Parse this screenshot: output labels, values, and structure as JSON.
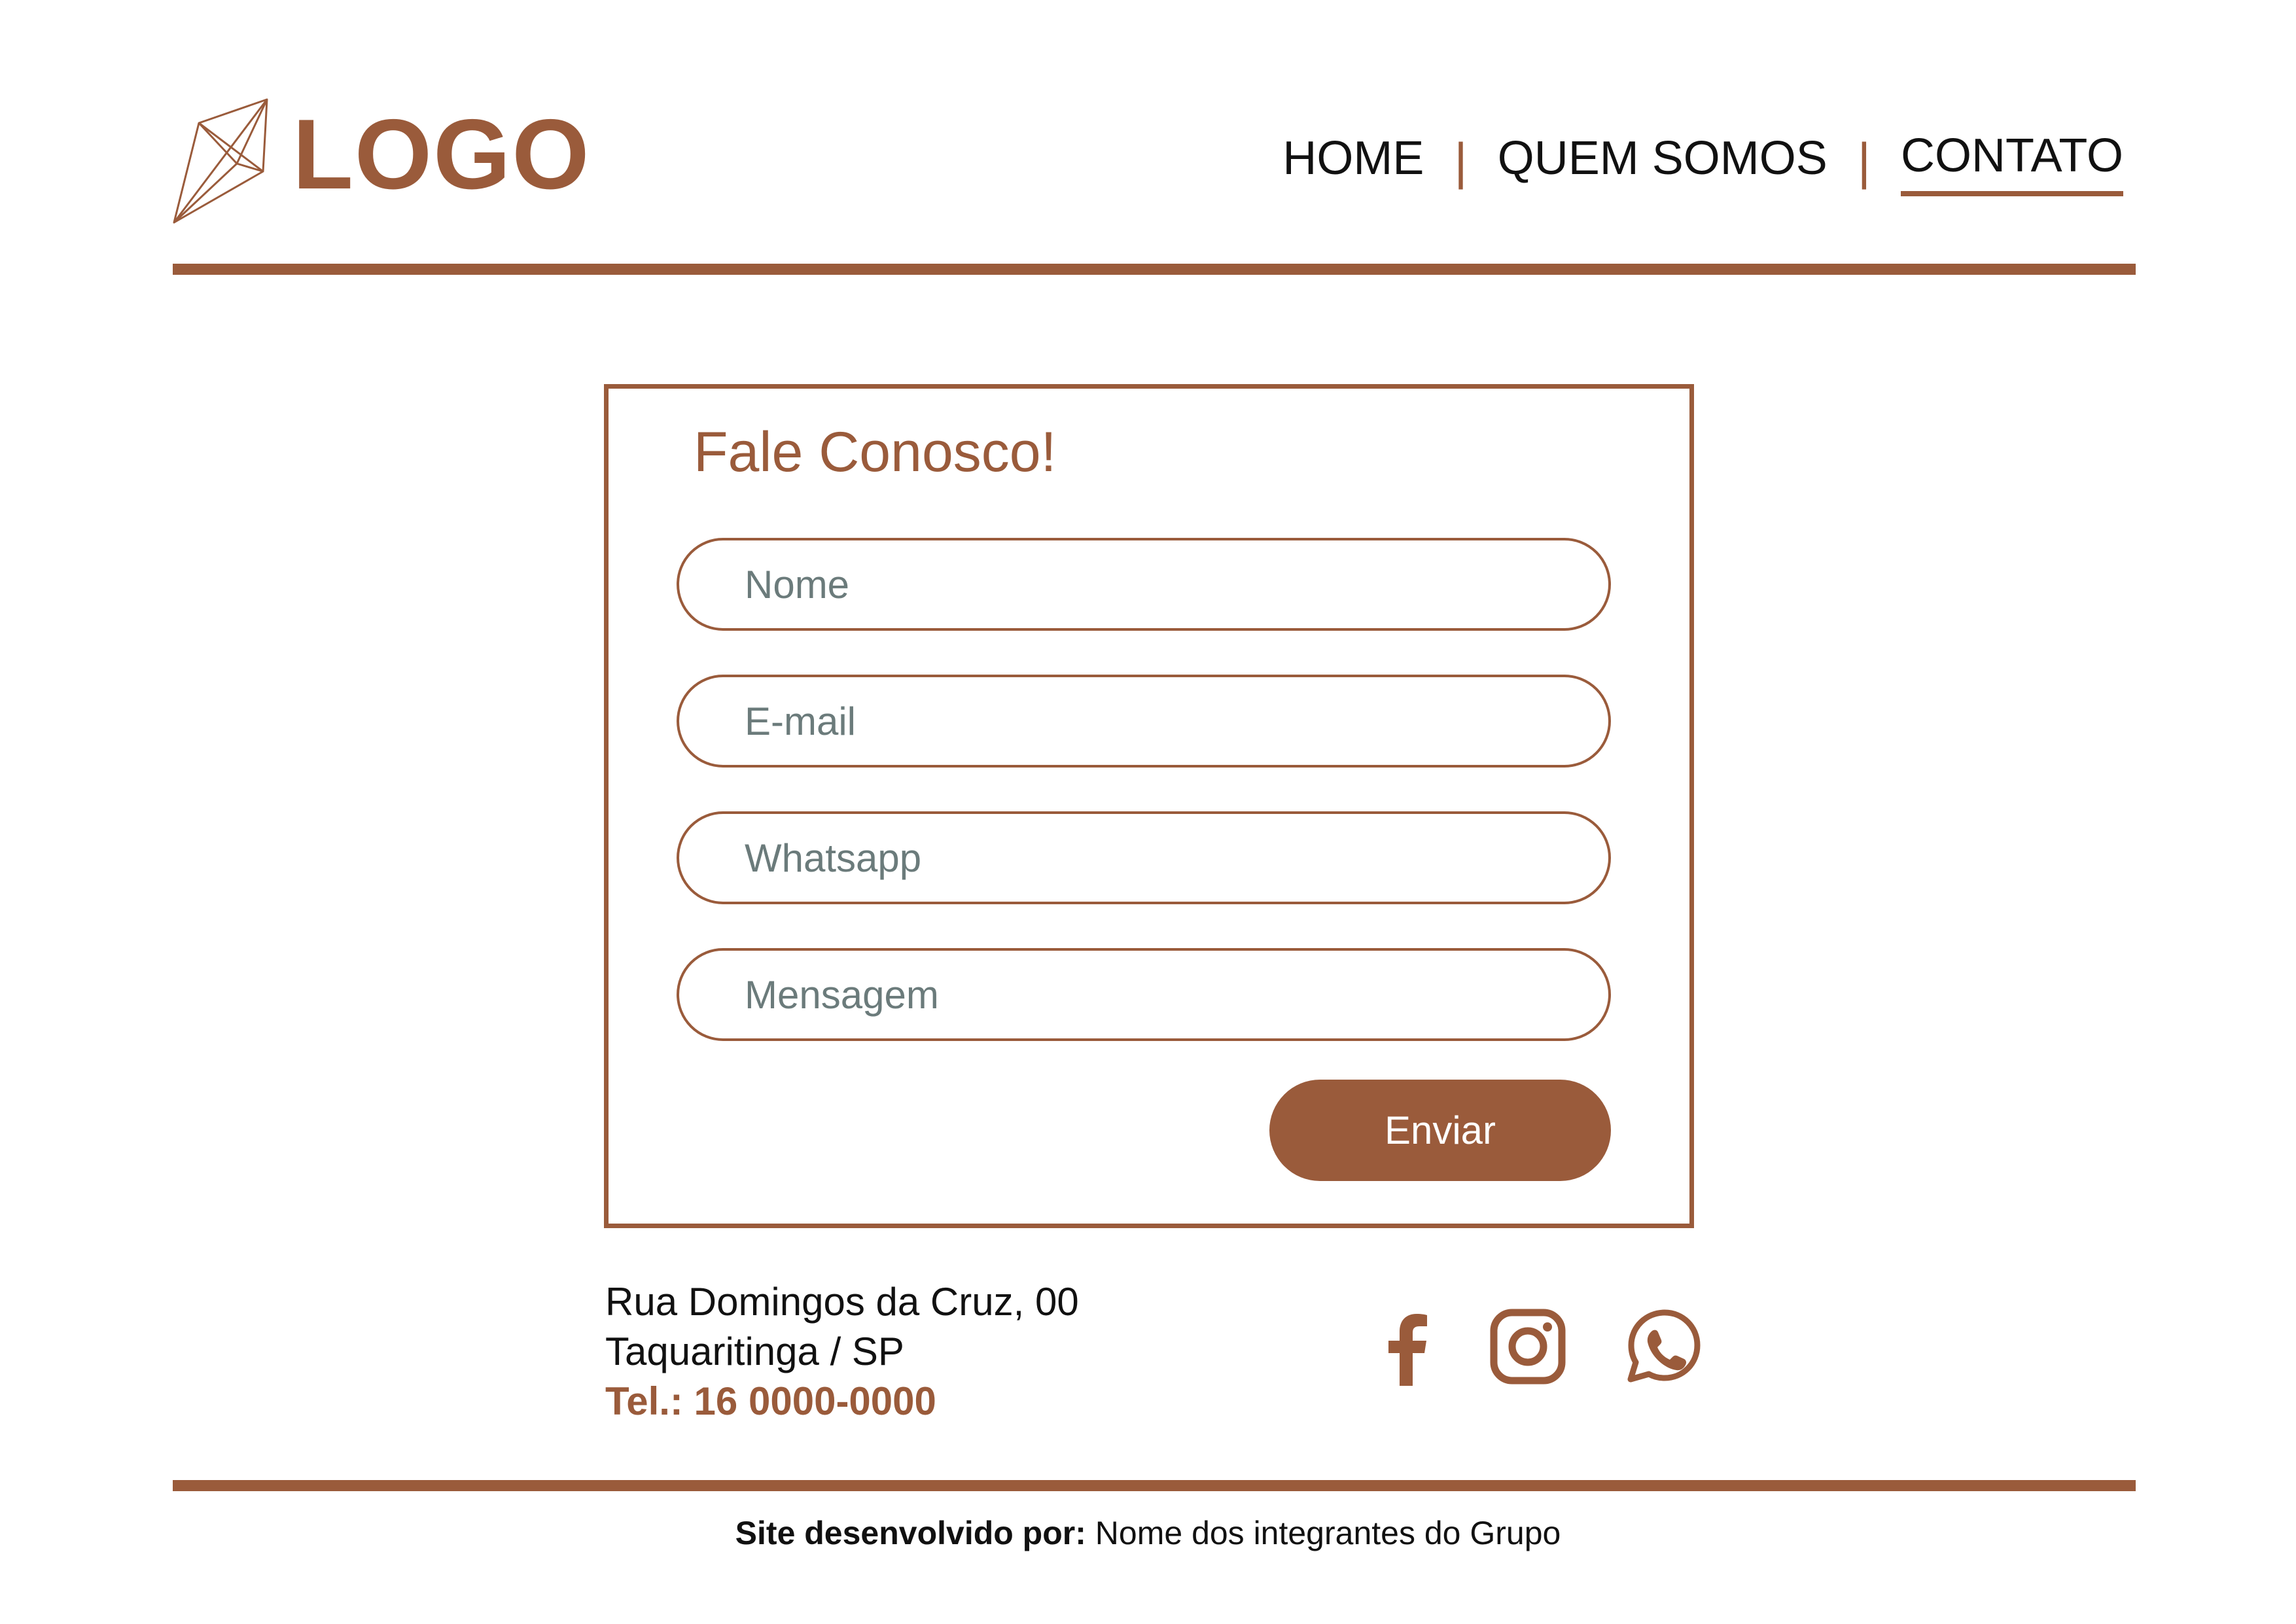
{
  "colors": {
    "accent": "#9a5b3b",
    "text": "#111111",
    "placeholder": "#6b7b7b",
    "background": "#ffffff"
  },
  "header": {
    "logo_text": "LOGO",
    "logo_icon": "diamond-icon",
    "nav": [
      {
        "label": "HOME",
        "active": false
      },
      {
        "label": "QUEM SOMOS",
        "active": false
      },
      {
        "label": "CONTATO",
        "active": true
      }
    ],
    "separator": "|"
  },
  "form": {
    "title": "Fale Conosco!",
    "fields": [
      {
        "name": "nome",
        "value": "",
        "placeholder": "Nome"
      },
      {
        "name": "email",
        "value": "",
        "placeholder": "E-mail"
      },
      {
        "name": "whatsapp",
        "value": "",
        "placeholder": "Whatsapp"
      },
      {
        "name": "mensagem",
        "value": "",
        "placeholder": "Mensagem"
      }
    ],
    "submit_label": "Enviar"
  },
  "contact": {
    "address_line1": "Rua Domingos da Cruz, 00",
    "address_line2": "Taquaritinga / SP",
    "phone": "Tel.: 16 0000-0000"
  },
  "social": [
    {
      "icon": "facebook-icon"
    },
    {
      "icon": "instagram-icon"
    },
    {
      "icon": "whatsapp-icon"
    }
  ],
  "footer": {
    "credits_label": "Site desenvolvido por:",
    "credits_value": "Nome dos integrantes do Grupo"
  }
}
